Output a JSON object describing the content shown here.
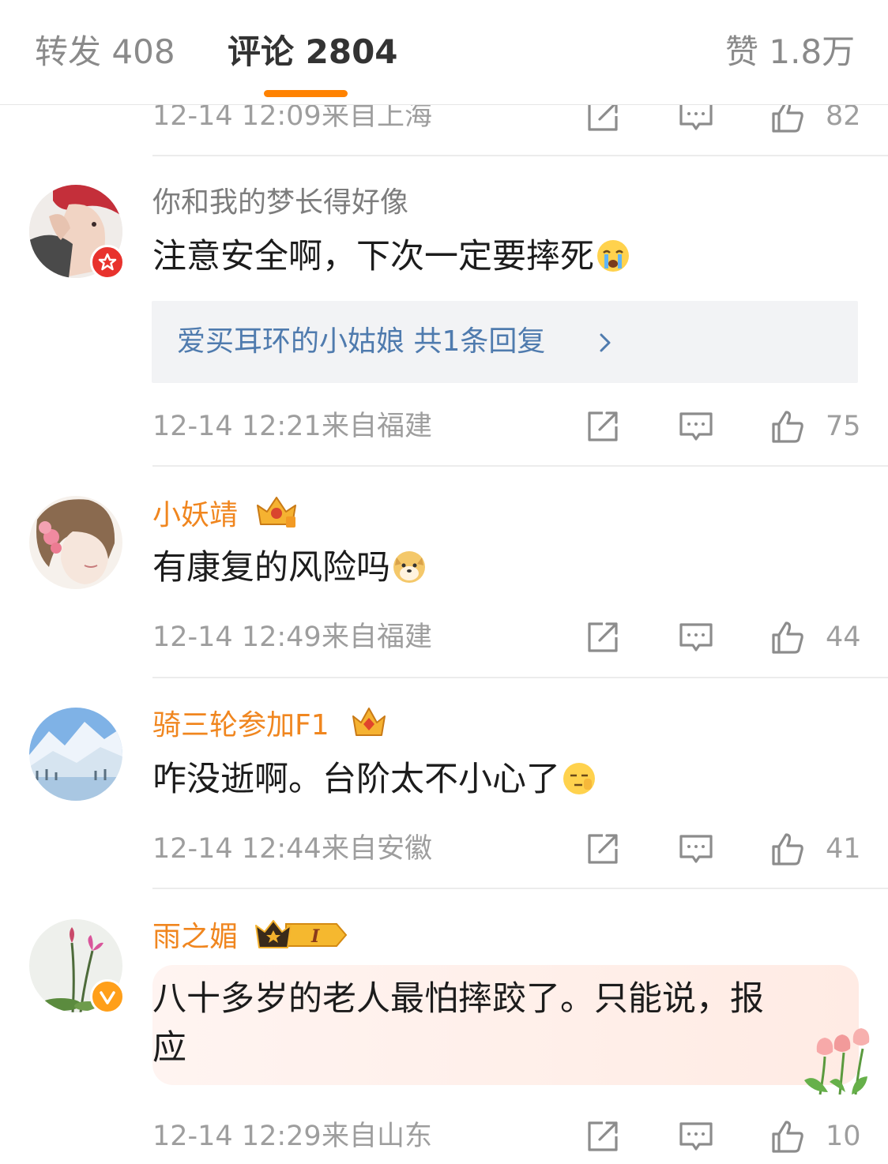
{
  "tabs": [
    {
      "label": "转发",
      "count": "408"
    },
    {
      "label": "评论",
      "count": "2804"
    },
    {
      "label": "赞",
      "count": "1.8万"
    }
  ],
  "comments": [
    {
      "time": "12-14 12:09",
      "location": "来自上海",
      "likes": "82"
    },
    {
      "username": "你和我的梦长得好像",
      "text": "注意安全啊，下次一定要摔死",
      "reply_user": "爱买耳环的小姑娘",
      "reply_count": "共1条回复",
      "time": "12-14 12:21",
      "location": "来自福建",
      "likes": "75"
    },
    {
      "username": "小妖靖",
      "text": "有康复的风险吗",
      "time": "12-14 12:49",
      "location": "来自福建",
      "likes": "44"
    },
    {
      "username": "骑三轮参加F1",
      "text": "咋没逝啊。台阶太不小心了",
      "time": "12-14 12:44",
      "location": "来自安徽",
      "likes": "41"
    },
    {
      "username": "雨之媚",
      "text_line1": "八十多岁的老人最怕摔跤了。只能说，报",
      "text_line2": "应",
      "time": "12-14 12:29",
      "location": "来自山东",
      "likes": "10"
    }
  ],
  "colors": {
    "accent": "#ff8200",
    "vip_name": "#f0861f",
    "link": "#4f7bae",
    "meta": "#9e9e9e"
  }
}
